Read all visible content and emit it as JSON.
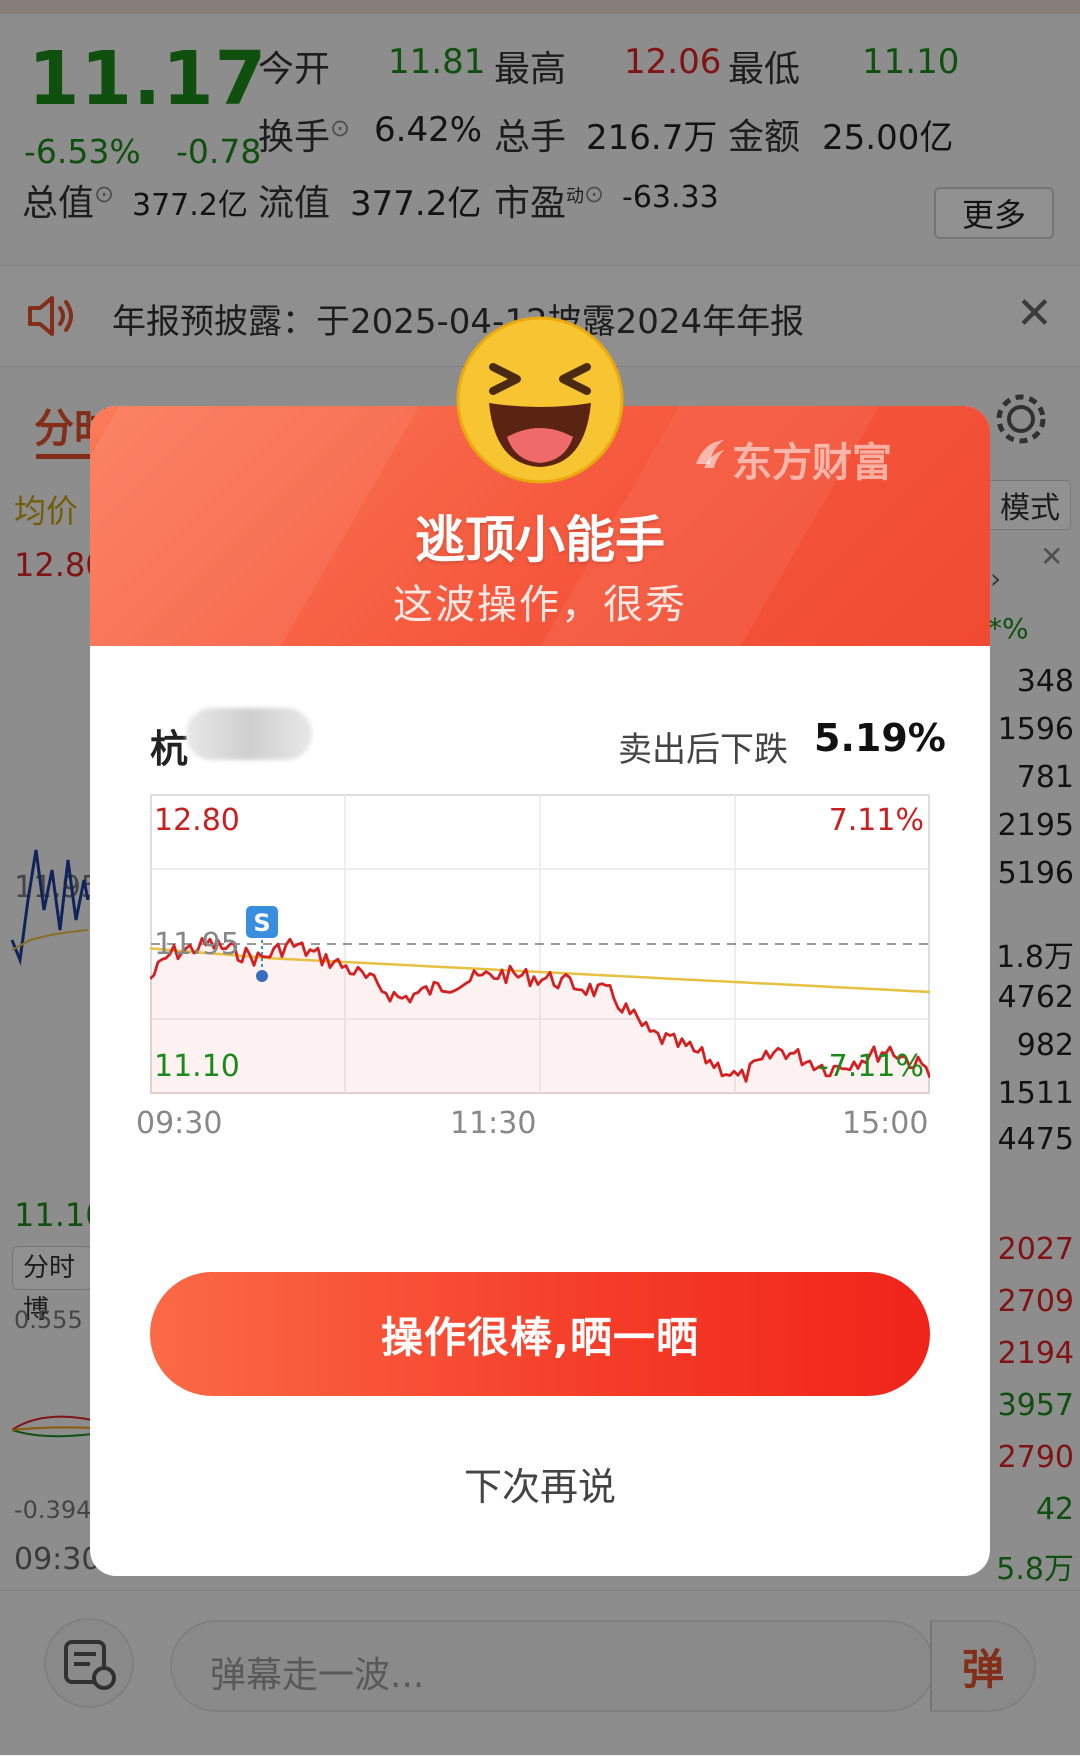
{
  "quote": {
    "price": "11.17",
    "change_pct": "-6.53%",
    "change": "-0.78",
    "open_label": "今开",
    "open": "11.81",
    "high_label": "最高",
    "high": "12.06",
    "low_label": "最低",
    "low": "11.10",
    "turnover_label": "换手",
    "turnover": "6.42%",
    "volume_label": "总手",
    "volume": "216.7万",
    "amount_label": "金额",
    "amount": "25.00亿",
    "mktcap_label": "总值",
    "mktcap": "377.2亿",
    "float_label": "流值",
    "float": "377.2亿",
    "pe_label": "市盈",
    "pe_sup": "动",
    "pe": "-63.33",
    "more_label": "更多"
  },
  "notice": {
    "text": "年报预披露：于2025-04-12披露2024年年报"
  },
  "tabs": {
    "active": "分时"
  },
  "background": {
    "avg_label": "均价",
    "mode_label": "模式",
    "price_top": "12.80",
    "price_mid": "11.95",
    "price_low": "11.10",
    "panel_label": "分时博",
    "ind_top": "0.555",
    "ind_low": "-0.394",
    "time_left": "09:30",
    "pct_header": "*%",
    "side_values": [
      {
        "v": "348",
        "c": "k"
      },
      {
        "v": "1596",
        "c": "k"
      },
      {
        "v": "781",
        "c": "k"
      },
      {
        "v": "2195",
        "c": "k"
      },
      {
        "v": "5196",
        "c": "k"
      },
      {
        "v": "1.8万",
        "c": "k"
      },
      {
        "v": "4762",
        "c": "k"
      },
      {
        "v": "982",
        "c": "k"
      },
      {
        "v": "1511",
        "c": "k"
      },
      {
        "v": "4475",
        "c": "k"
      },
      {
        "v": "2027",
        "c": "r"
      },
      {
        "v": "2709",
        "c": "r"
      },
      {
        "v": "2194",
        "c": "r"
      },
      {
        "v": "3957",
        "c": "g"
      },
      {
        "v": "2790",
        "c": "r"
      },
      {
        "v": "42",
        "c": "g"
      },
      {
        "v": "5.8万",
        "c": "g"
      }
    ]
  },
  "chat": {
    "placeholder": "弹幕走一波...",
    "danmu_label": "弹"
  },
  "modal": {
    "brand": "东方财富",
    "title": "逃顶小能手",
    "subtitle": "这波操作，很秀",
    "stock_name_visible": "杭",
    "drop_label": "卖出后下跌",
    "drop_value": "5.19%",
    "chart_labels": {
      "top_price": "12.80",
      "top_pct": "7.11%",
      "mid_price": "11.95",
      "low_price": "11.10",
      "low_pct": "-7.11%",
      "sell_marker": "S"
    },
    "times": [
      "09:30",
      "11:30",
      "15:00"
    ],
    "share_button": "操作很棒,晒一晒",
    "later_button": "下次再说"
  },
  "colors": {
    "down": "#1a8a1a",
    "up": "#d22222",
    "accent": "#f5573c",
    "avg_line": "#e8c040",
    "price_line": "#d42020"
  }
}
